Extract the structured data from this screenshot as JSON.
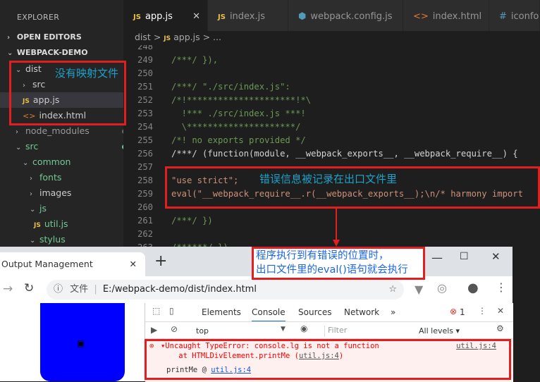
{
  "sidebar": {
    "title": "EXPLORER",
    "open_editors": "OPEN EDITORS",
    "project": "WEBPACK-DEMO",
    "items": [
      {
        "label": "dist",
        "kind": "folder-open"
      },
      {
        "label": "src",
        "kind": "folder"
      },
      {
        "label": "app.js",
        "kind": "js"
      },
      {
        "label": "index.html",
        "kind": "html"
      },
      {
        "label": "node_modules",
        "kind": "folder"
      },
      {
        "label": "src",
        "kind": "folder-open"
      },
      {
        "label": "common",
        "kind": "folder-open"
      },
      {
        "label": "fonts",
        "kind": "folder"
      },
      {
        "label": "images",
        "kind": "folder"
      },
      {
        "label": "js",
        "kind": "folder-open"
      },
      {
        "label": "util.js",
        "kind": "js",
        "badge": "U"
      },
      {
        "label": "stylus",
        "kind": "folder-open"
      }
    ]
  },
  "tabs": [
    "app.js",
    "index.js",
    "webpack.config.js",
    "index.html",
    "iconfo"
  ],
  "breadcrumb": {
    "folder": "dist",
    "sep": ">",
    "file": "app.js",
    "rest": "> ..."
  },
  "editor": {
    "lines": [
      {
        "n": "248",
        "html": ""
      },
      {
        "n": "249",
        "text": "/***/ }),",
        "cls": "cm"
      },
      {
        "n": "250",
        "text": ""
      },
      {
        "n": "251",
        "text": "/***/ \"./src/index.js\":",
        "cls": "cm"
      },
      {
        "n": "252",
        "text": "/*!*********************!*\\",
        "cls": "cm"
      },
      {
        "n": "253",
        "text": "  !*** ./src/index.js ***!",
        "cls": "cm"
      },
      {
        "n": "254",
        "text": "  \\*********************/",
        "cls": "cm"
      },
      {
        "n": "255",
        "text": "/*! no exports provided */",
        "cls": "cm"
      },
      {
        "n": "256",
        "text": "/***/ (function(module, __webpack_exports__, __webpack_require__) {",
        "cls": "mixed"
      },
      {
        "n": "257",
        "text": ""
      },
      {
        "n": "258",
        "text": "\"use strict\";",
        "cls": "str"
      },
      {
        "n": "259",
        "text": "eval(\"__webpack_require__.r(__webpack_exports__);\\n/* harmony import",
        "cls": "eval"
      },
      {
        "n": "260",
        "text": ""
      },
      {
        "n": "261",
        "text": "/***/ })",
        "cls": "cm"
      },
      {
        "n": "262",
        "text": "",
        "cls": ""
      },
      {
        "n": "263",
        "text": "/******/ })",
        "cls": "cm"
      }
    ]
  },
  "annotations": {
    "no_map": "没有映射文件",
    "error_recorded": "错误信息被记录在出口文件里",
    "callout_line1": "程序执行到有错误的位置时，",
    "callout_line2": "出口文件里的eval()语句就会执行"
  },
  "browser": {
    "tab_title": "Output Management",
    "new_tab": "+",
    "url_prefix": "文件",
    "url": "E:/webpack-demo/dist/index.html",
    "devtools": {
      "tabs": [
        "Elements",
        "Console",
        "Sources",
        "Network"
      ],
      "more": "»",
      "error_count": "1",
      "context": "top",
      "filter_placeholder": "Filter",
      "levels": "All levels ▾",
      "error_line1": "▾Uncaught TypeError: console.lg is not a function",
      "error_line2": "    at HTMLDivElement.printMe (",
      "error_line2_link": "util.js:4",
      "error_line2_end": ")",
      "error_source": "util.js:4",
      "printme": "printMe @ ",
      "printme_link": "util.js:4"
    }
  }
}
